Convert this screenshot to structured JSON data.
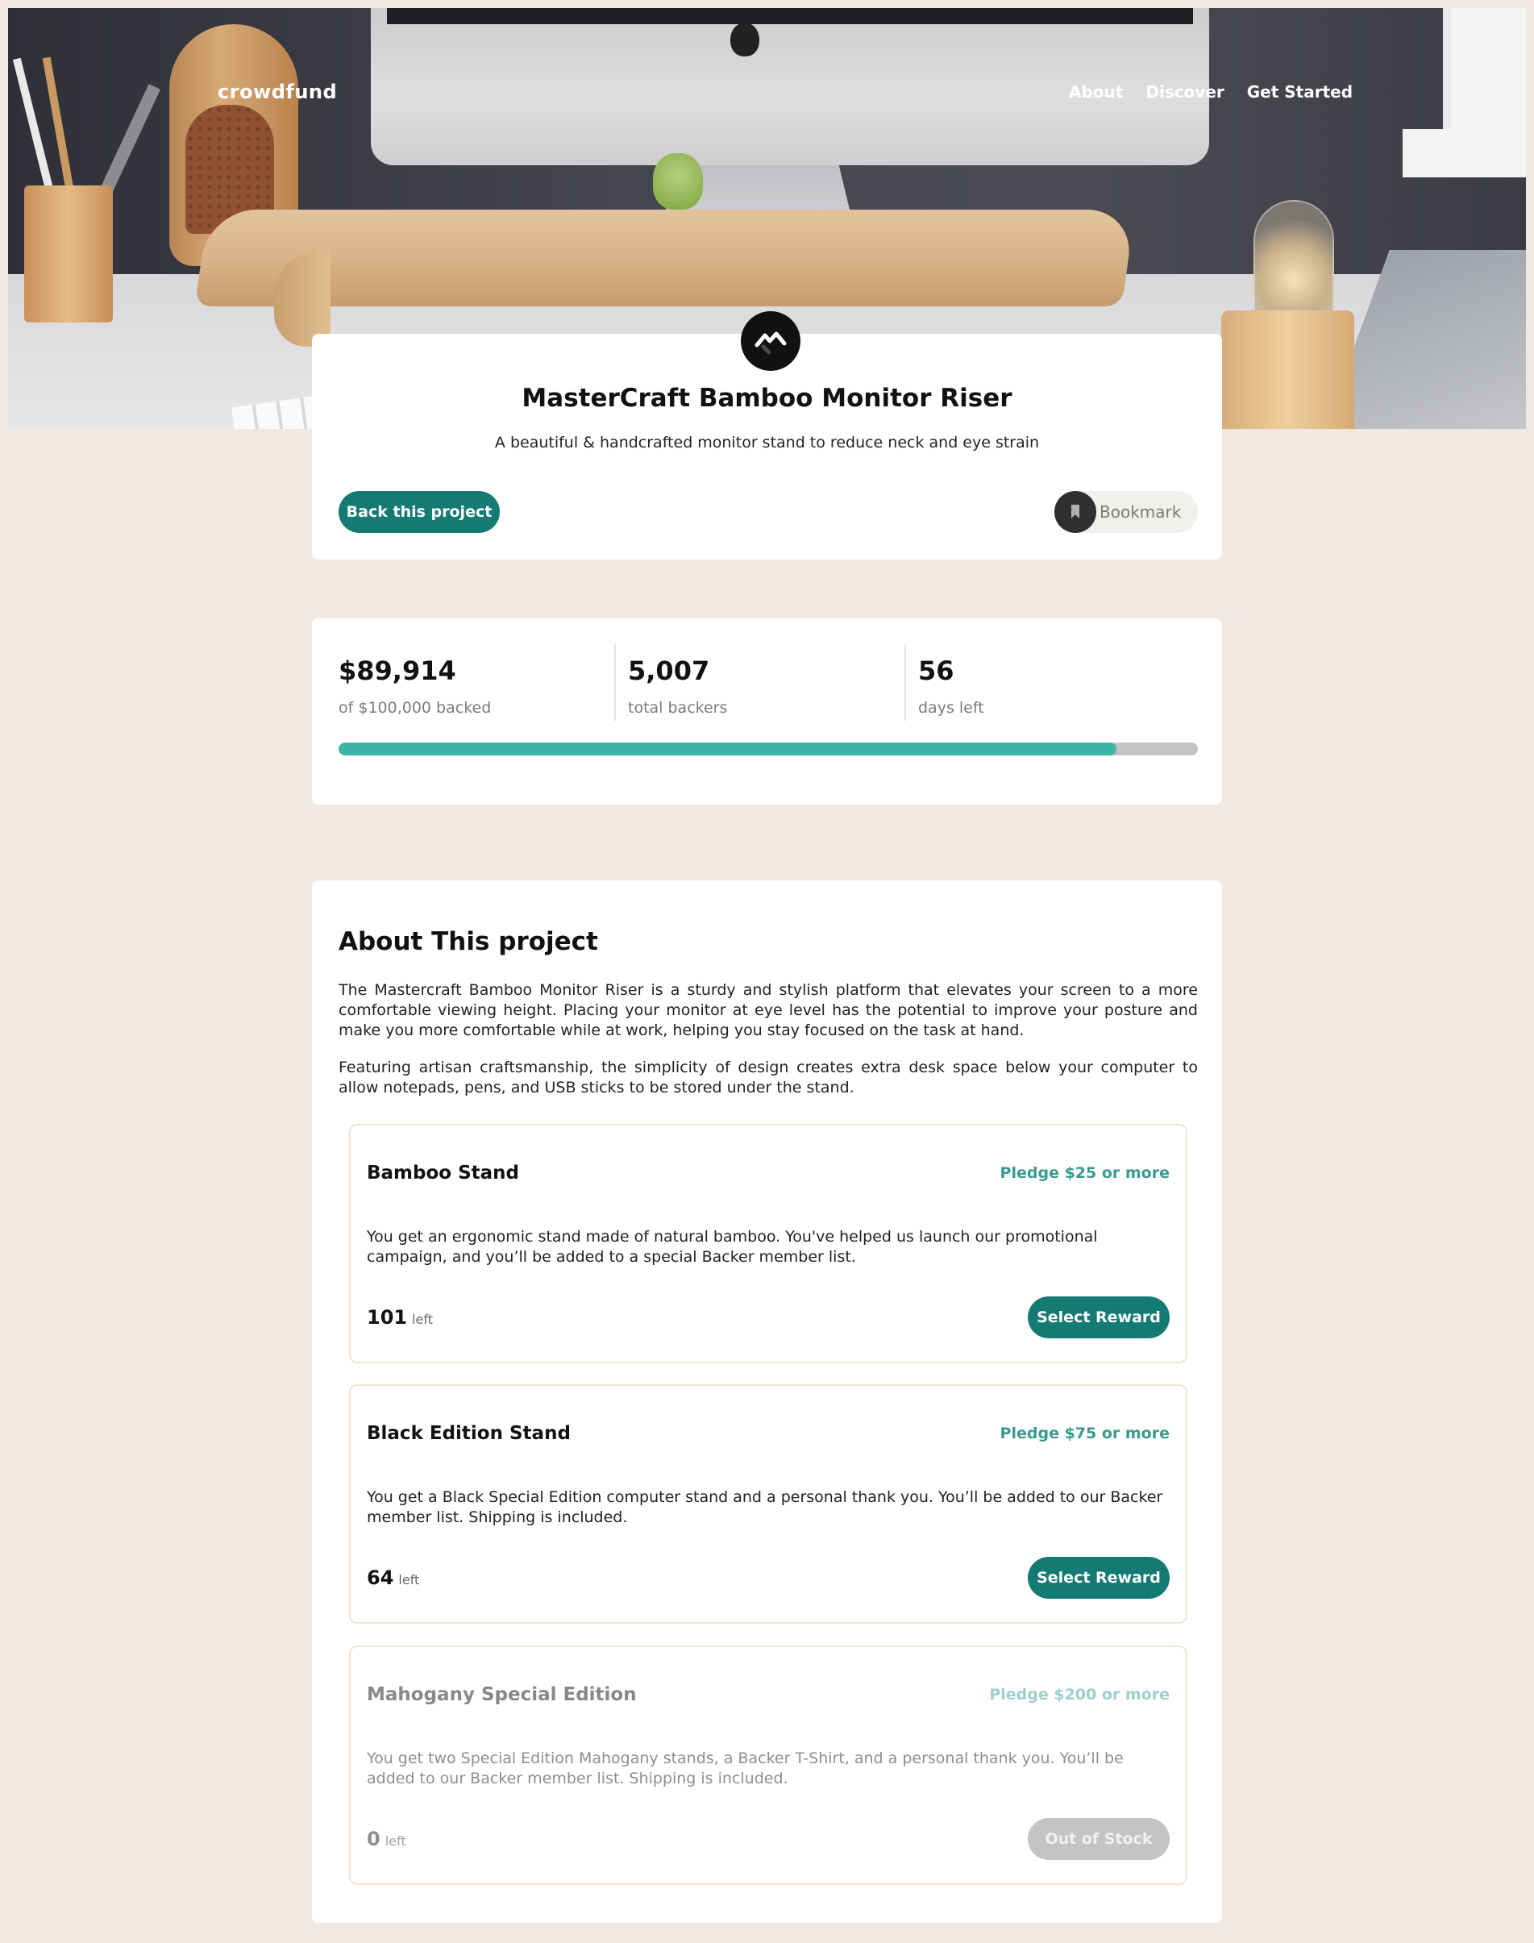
{
  "header": {
    "logo": "crowdfund",
    "nav": [
      "About",
      "Discover",
      "Get Started"
    ]
  },
  "project": {
    "title": "MasterCraft Bamboo Monitor Riser",
    "subtitle": "A beautiful & handcrafted monitor stand to reduce neck and eye strain",
    "back_label": "Back this project",
    "bookmark_label": "Bookmark"
  },
  "stats": {
    "backed_value": "$89,914",
    "backed_label": "of $100,000 backed",
    "backers_value": "5,007",
    "backers_label": "total backers",
    "days_value": "56",
    "days_label": "days left",
    "progress_fraction": 0.905
  },
  "about": {
    "title": "About This project",
    "p1": "The Mastercraft Bamboo Monitor Riser is a sturdy and stylish platform that elevates your screen to a more comfortable viewing height. Placing your monitor at eye level has the potential to improve your posture and make you more comfortable while at work, helping you stay focused on the task at hand.",
    "p2": "Featuring artisan craftsmanship, the simplicity of design creates extra desk space below your computer to allow notepads, pens, and USB sticks to be stored under the stand."
  },
  "rewards": [
    {
      "name": "Bamboo Stand",
      "pledge": "Pledge $25 or more",
      "desc": "You get an ergonomic stand made of natural bamboo. You've helped us launch our promotional campaign, and you’ll be added to a special Backer member list.",
      "count": "101",
      "left_label": "left",
      "button": "Select Reward"
    },
    {
      "name": "Black Edition Stand",
      "pledge": "Pledge $75 or more",
      "desc": "You get a Black Special Edition computer stand and a personal thank you. You’ll be added to our Backer member list. Shipping is included.",
      "count": "64",
      "left_label": "left",
      "button": "Select Reward"
    },
    {
      "name": "Mahogany Special Edition",
      "pledge": "Pledge $200 or more",
      "desc": "You get two Special Edition Mahogany stands, a Backer T-Shirt, and a personal thank you. You’ll be added to our Backer member list. Shipping is included.",
      "count": "0",
      "left_label": "left",
      "button": "Out of Stock"
    }
  ],
  "colors": {
    "page_bg": "#f1e9e0",
    "accent": "#147b74",
    "accent_light": "#3cb4a8",
    "track": "#c4c4c4"
  },
  "icons": {
    "brand": "mastercraft-logo-icon",
    "bookmark": "bookmark-icon"
  }
}
